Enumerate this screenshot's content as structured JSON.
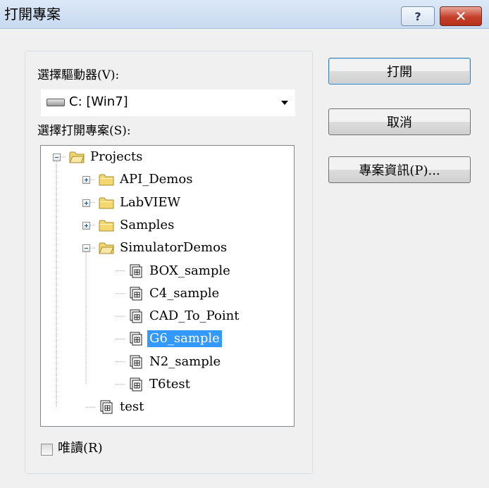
{
  "window": {
    "title": "打開專案",
    "help_glyph": "?",
    "close_glyph": "✕"
  },
  "drive": {
    "label": "選擇驅動器(V):",
    "selected": "C: [Win7]"
  },
  "project": {
    "label": "選擇打開專案(S):",
    "tree": [
      {
        "label": "Projects",
        "type": "folder-open",
        "depth": 0,
        "expander": "minus"
      },
      {
        "label": "API_Demos",
        "type": "folder",
        "depth": 1,
        "expander": "plus"
      },
      {
        "label": "LabVIEW",
        "type": "folder",
        "depth": 1,
        "expander": "plus"
      },
      {
        "label": "Samples",
        "type": "folder",
        "depth": 1,
        "expander": "plus"
      },
      {
        "label": "SimulatorDemos",
        "type": "folder-open",
        "depth": 1,
        "expander": "minus"
      },
      {
        "label": "BOX_sample",
        "type": "project",
        "depth": 2
      },
      {
        "label": "C4_sample",
        "type": "project",
        "depth": 2
      },
      {
        "label": "CAD_To_Point",
        "type": "project",
        "depth": 2
      },
      {
        "label": "G6_sample",
        "type": "project",
        "depth": 2,
        "selected": true
      },
      {
        "label": "N2_sample",
        "type": "project",
        "depth": 2
      },
      {
        "label": "T6test",
        "type": "project",
        "depth": 2
      },
      {
        "label": "test",
        "type": "project",
        "depth": 1
      }
    ]
  },
  "readonly": {
    "label": "唯讀(R)",
    "checked": false
  },
  "buttons": {
    "open": "打開",
    "cancel": "取消",
    "info": "專案資訊(P)..."
  },
  "colors": {
    "selection": "#3399ff",
    "folder": "#f4d76e",
    "close": "#c5402a"
  }
}
